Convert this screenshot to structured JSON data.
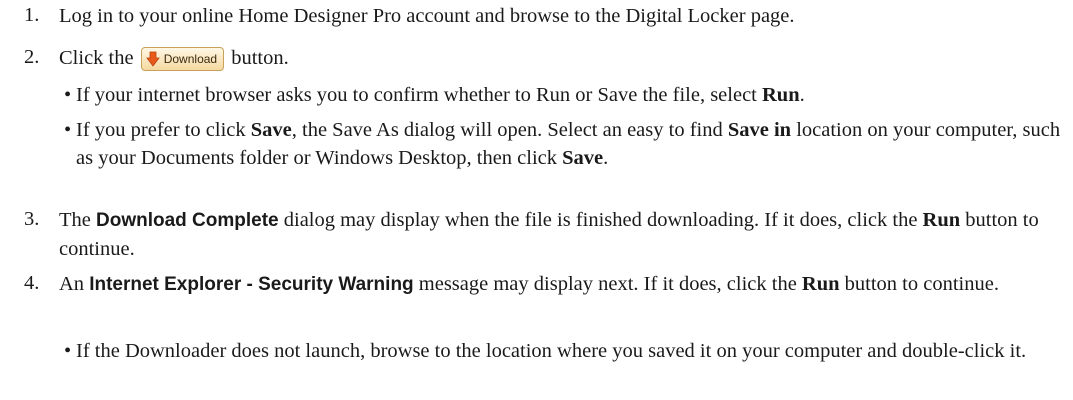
{
  "steps": [
    {
      "num": "1.",
      "text": "Log in to your online Home Designer Pro account and browse to the Digital Locker page."
    },
    {
      "num": "2.",
      "pre": "Click the",
      "button_label": "Download",
      "post": "button."
    },
    {
      "num": "3.",
      "a": "The",
      "b1": "Download Complete",
      "c": "dialog may display when the file is finished downloading. If it does,",
      "d": "click the",
      "b2": "Run",
      "e": "button to continue."
    },
    {
      "num": "4.",
      "a": "An",
      "b1": "Internet Explorer - Security Warning",
      "c": "message may display next. If it does, click the",
      "b2": "Run",
      "e": "button to continue."
    }
  ],
  "bullets": {
    "b1": {
      "a": "If your internet browser asks you to confirm whether to Run or Save the file, select",
      "b": "Run",
      "c": "."
    },
    "b2": {
      "a": "If you prefer to click",
      "b": "Save",
      "c": ", the Save As dialog will open. Select an easy to find",
      "d": "Save in",
      "e": "location on your computer, such as your Documents folder or Windows Desktop, then click",
      "f": "Save",
      "g": "."
    },
    "b3": {
      "text": "If the Downloader does not launch, browse to the location where you saved it on your computer and double-click it."
    }
  },
  "glyphs": {
    "bullet": "•"
  },
  "icons": {
    "download": "download-arrow-icon"
  },
  "colors": {
    "icon_orange": "#e8591a"
  }
}
